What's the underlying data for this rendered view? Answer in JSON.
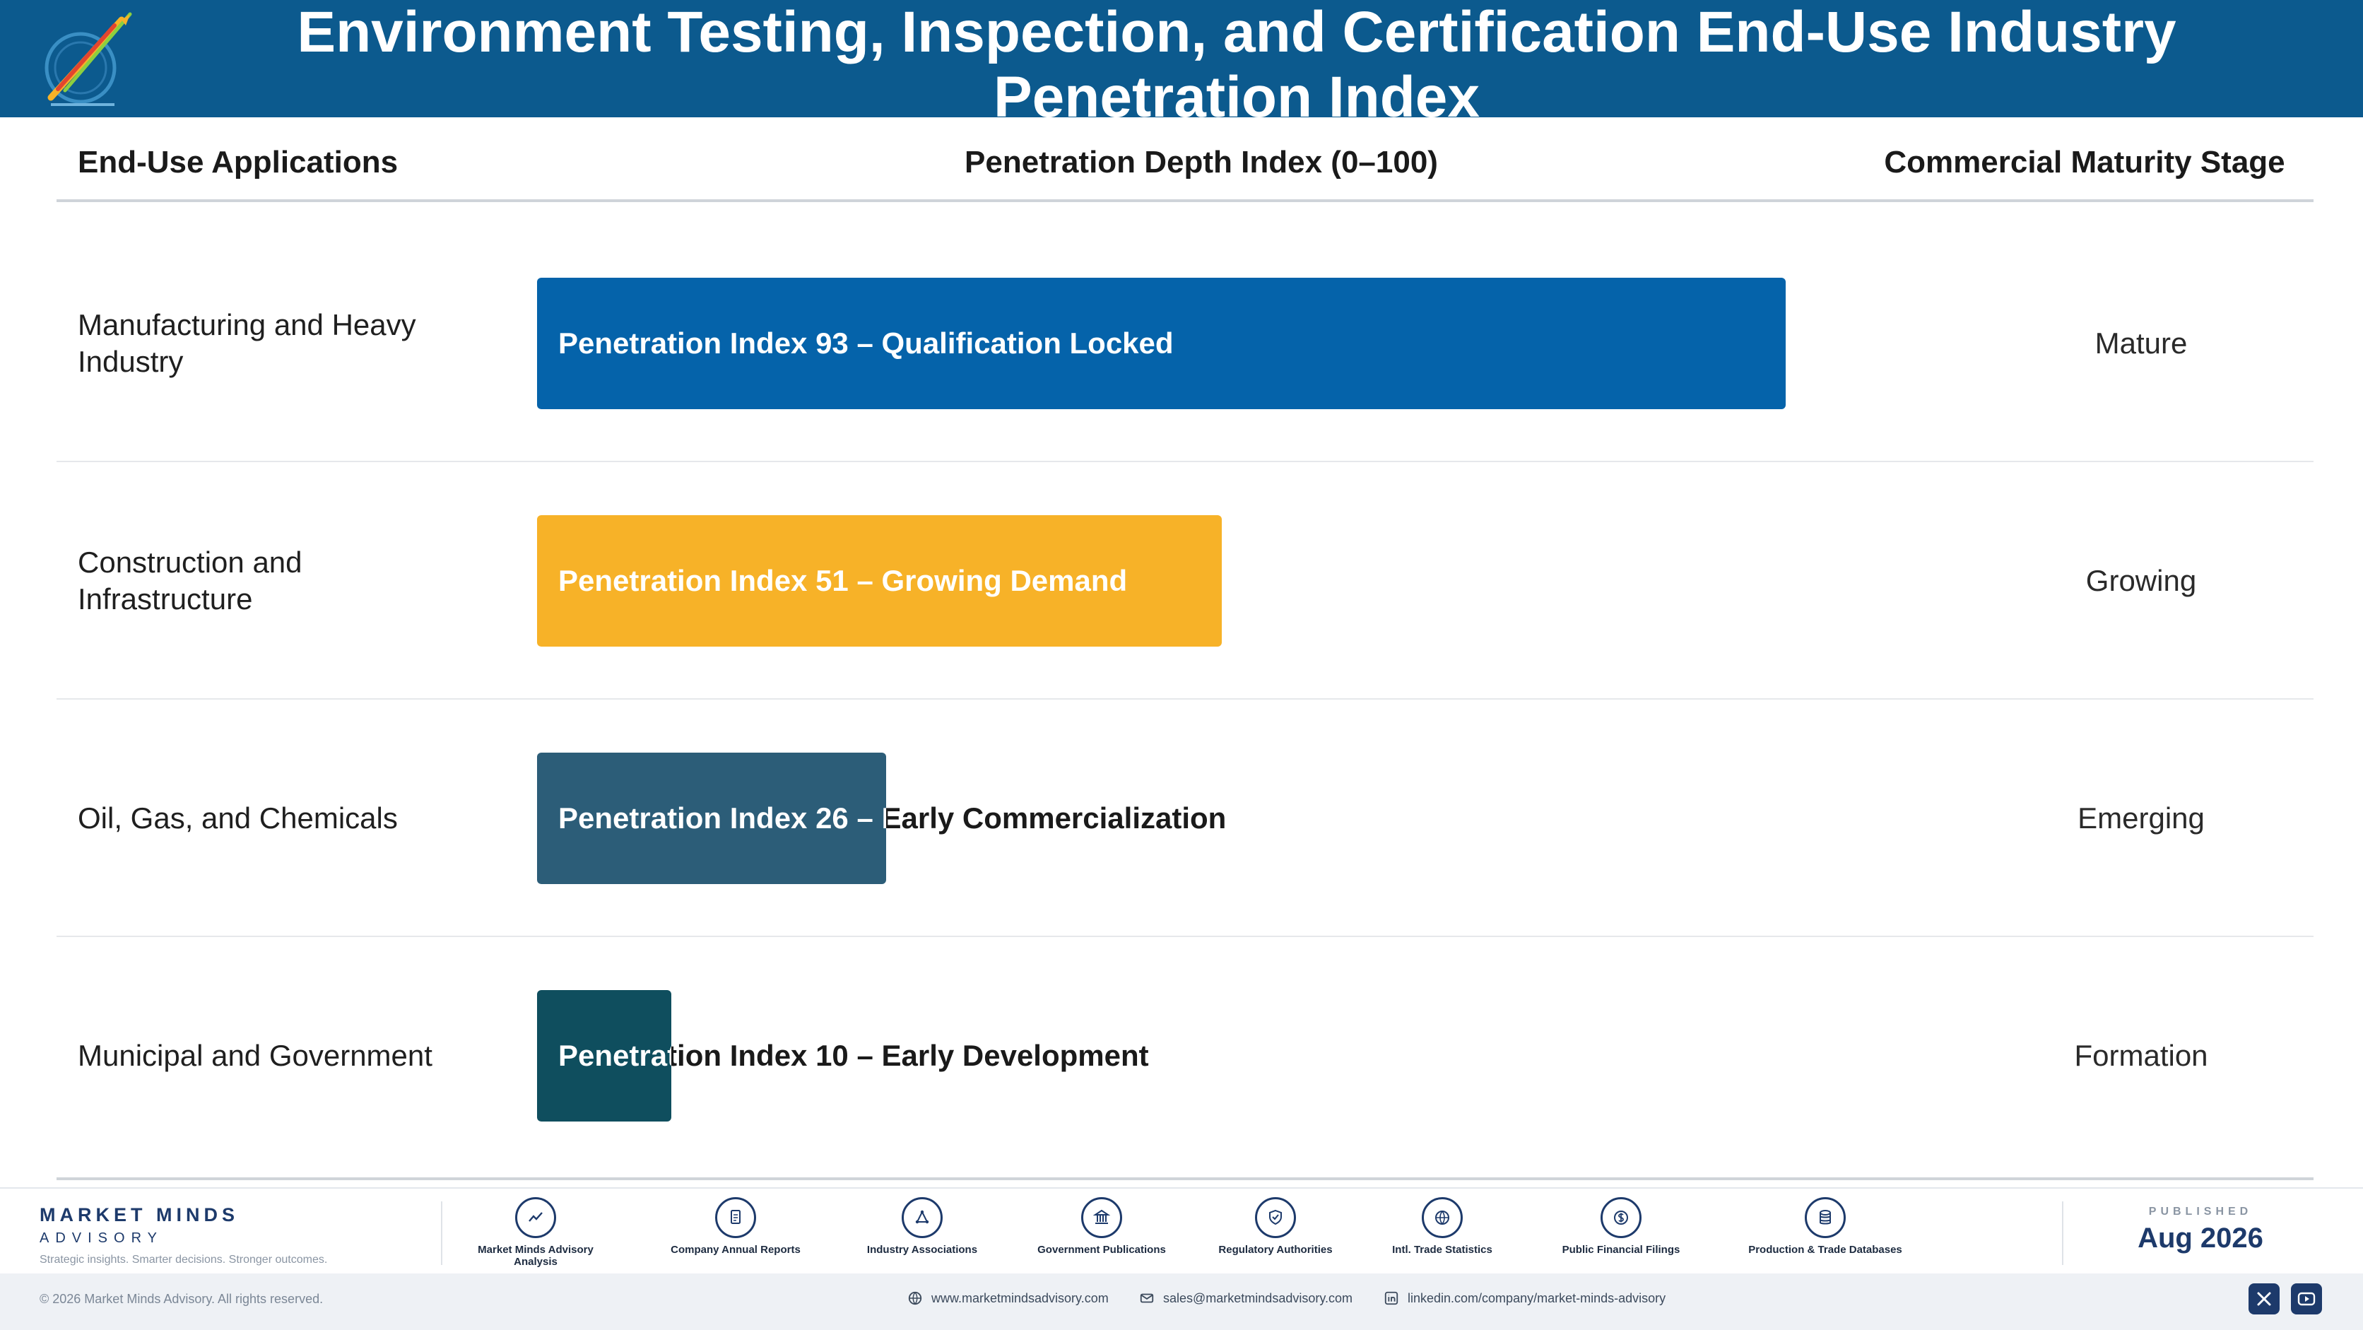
{
  "header": {
    "title": "Environment Testing, Inspection, and Certification End-Use Industry Penetration Index",
    "logo_icon": "market-minds-logo-icon"
  },
  "chart_data": {
    "type": "bar",
    "orientation": "horizontal",
    "columns": {
      "app": "End-Use Applications",
      "index": "Penetration Depth Index (0–100)",
      "maturity": "Commercial Maturity Stage"
    },
    "xlim": [
      0,
      100
    ],
    "rows": [
      {
        "category": "Manufacturing and Heavy Industry",
        "value": 93,
        "bar_label": "Penetration Index 93 – Qualification Locked",
        "maturity": "Mature",
        "color": "#0563aa",
        "label_color": "#ffffff"
      },
      {
        "category": "Construction and Infrastructure",
        "value": 51,
        "bar_label": "Penetration Index 51 – Growing Demand",
        "maturity": "Growing",
        "color": "#f7b228",
        "label_color": "#ffffff"
      },
      {
        "category": "Oil, Gas, and Chemicals",
        "value": 26,
        "bar_label": "Penetration Index 26 – Early Commercialization",
        "maturity": "Emerging",
        "color": "#2c5d78",
        "label_color": "#ffffff"
      },
      {
        "category": "Municipal and Government",
        "value": 10,
        "bar_label": "Penetration Index 10 – Early Development",
        "maturity": "Formation",
        "color": "#0f4e5e",
        "label_color": "#ffffff"
      }
    ]
  },
  "footer": {
    "brand_name": "MARKET MINDS",
    "brand_sub": "ADVISORY",
    "brand_tag": "Strategic insights. Smarter decisions. Stronger outcomes.",
    "sources": [
      {
        "label": "Market Minds Advisory Analysis",
        "icon": "trend-line-icon"
      },
      {
        "label": "Company Annual Reports",
        "icon": "document-icon"
      },
      {
        "label": "Industry Associations",
        "icon": "network-icon"
      },
      {
        "label": "Government Publications",
        "icon": "government-building-icon"
      },
      {
        "label": "Regulatory Authorities",
        "icon": "shield-check-icon"
      },
      {
        "label": "Intl. Trade Statistics",
        "icon": "globe-icon"
      },
      {
        "label": "Public Financial Filings",
        "icon": "dollar-coin-icon"
      },
      {
        "label": "Production & Trade Databases",
        "icon": "database-icon"
      }
    ],
    "published_label": "PUBLISHED",
    "published_date": "Aug 2026",
    "copyright": "© 2026 Market Minds Advisory. All rights reserved.",
    "website": "www.marketmindsadvisory.com",
    "email": "sales@marketmindsadvisory.com",
    "linkedin": "linkedin.com/company/market-minds-advisory",
    "social_icons": [
      "x-icon",
      "youtube-icon"
    ]
  }
}
